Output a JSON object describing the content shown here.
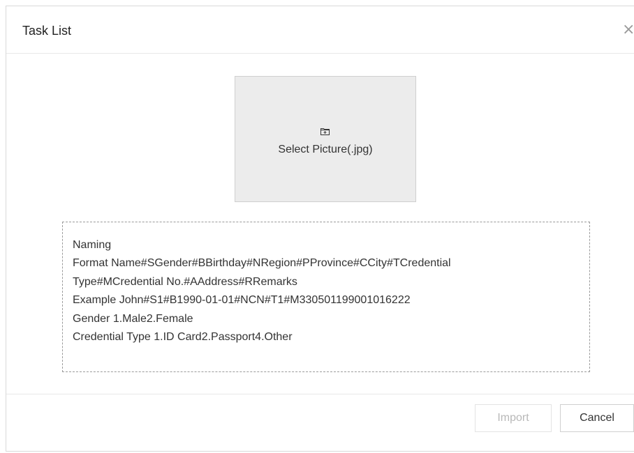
{
  "dialog": {
    "title": "Task List",
    "close_label": "×"
  },
  "picture_select": {
    "icon": "folder-icon",
    "label": "Select Picture(.jpg)"
  },
  "naming_rules": {
    "lines": [
      "Naming",
      "Format  Name#SGender#BBirthday#NRegion#PProvince#CCity#TCredential",
      "Type#MCredential No.#AAddress#RRemarks",
      "Example  John#S1#B1990-01-01#NCN#T1#M330501199001016222",
      "Gender  1.Male2.Female",
      "Credential Type  1.ID Card2.Passport4.Other"
    ]
  },
  "footer": {
    "import_label": "Import",
    "import_state": "disabled",
    "cancel_label": "Cancel"
  },
  "colors": {
    "picture_box_bg": "#ececec",
    "disabled_text": "#b8b8b8",
    "border": "#cfcfcf"
  }
}
